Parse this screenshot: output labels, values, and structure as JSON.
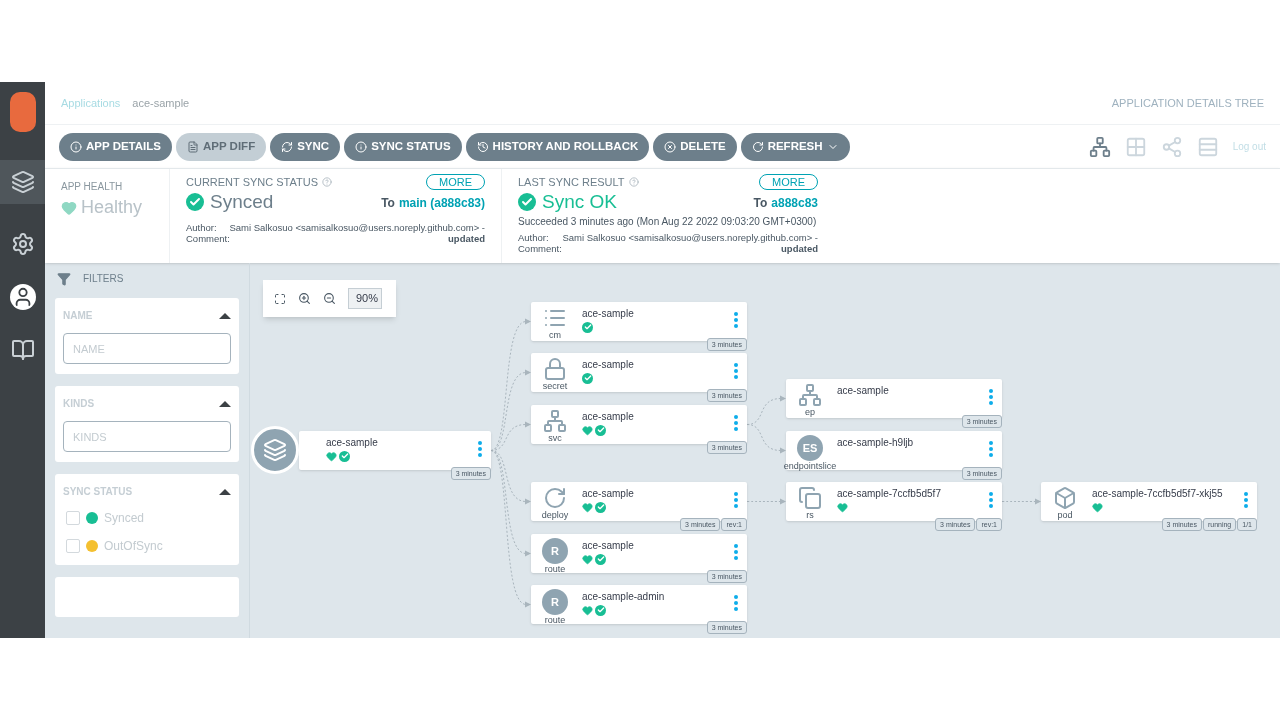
{
  "breadcrumb": [
    {
      "label": "Applications",
      "kind": "link"
    },
    {
      "label": "ace-sample",
      "kind": "current"
    }
  ],
  "page_title": "APPLICATION DETAILS TREE",
  "toolbar": [
    {
      "label": "APP DETAILS",
      "kind": "details",
      "disabled": false
    },
    {
      "label": "APP DIFF",
      "kind": "diff",
      "disabled": true
    },
    {
      "label": "SYNC",
      "kind": "sync",
      "disabled": false
    },
    {
      "label": "SYNC STATUS",
      "kind": "status",
      "disabled": false
    },
    {
      "label": "HISTORY AND ROLLBACK",
      "kind": "history",
      "disabled": false
    },
    {
      "label": "DELETE",
      "kind": "delete",
      "disabled": false
    },
    {
      "label": "REFRESH",
      "kind": "refresh",
      "disabled": false,
      "dropdown": true
    }
  ],
  "views": [
    {
      "kind": "tree",
      "selected": true
    },
    {
      "kind": "pods",
      "selected": false
    },
    {
      "kind": "network",
      "selected": false
    },
    {
      "kind": "list",
      "selected": false
    }
  ],
  "logout": "Log out",
  "app_health": {
    "title": "APP HEALTH",
    "value": "Healthy"
  },
  "current_sync": {
    "title": "CURRENT SYNC STATUS",
    "more": "MORE",
    "value": "Synced",
    "to_label": "To",
    "revision": "main (a888c83)",
    "author_label": "Author:",
    "author": "Sami Salkosuo <samisalkosuo@users.noreply.github.com> -",
    "comment_label": "Comment:",
    "comment": "updated"
  },
  "last_sync": {
    "title": "LAST SYNC RESULT",
    "more": "MORE",
    "value": "Sync OK",
    "to_label": "To",
    "revision": "a888c83",
    "detail": "Succeeded 3 minutes ago (Mon Aug 22 2022 09:03:20 GMT+0300)",
    "author_label": "Author:",
    "author": "Sami Salkosuo <samisalkosuo@users.noreply.github.com> -",
    "comment_label": "Comment:",
    "comment": "updated"
  },
  "filters": {
    "title": "FILTERS",
    "sections": [
      {
        "title": "NAME",
        "kind": "input",
        "placeholder": "NAME",
        "expanded": true
      },
      {
        "title": "KINDS",
        "kind": "input",
        "placeholder": "KINDS",
        "expanded": true
      },
      {
        "title": "SYNC STATUS",
        "kind": "checklist",
        "expanded": true,
        "options": [
          {
            "label": "Synced",
            "checked": false,
            "color": "#18be94"
          },
          {
            "label": "OutOfSync",
            "checked": false,
            "color": "#f4c030"
          }
        ]
      }
    ]
  },
  "graph": {
    "zoom": "90%",
    "root": {
      "kind": "app",
      "name": "ace-sample",
      "health": true,
      "synced": true,
      "badges": [
        "3 minutes"
      ],
      "children": [
        {
          "kind": "cm",
          "name": "ace-sample",
          "health": false,
          "synced": true,
          "badges": [
            "3 minutes"
          ]
        },
        {
          "kind": "secret",
          "name": "ace-sample",
          "health": false,
          "synced": true,
          "badges": [
            "3 minutes"
          ]
        },
        {
          "kind": "svc",
          "name": "ace-sample",
          "health": true,
          "synced": true,
          "badges": [
            "3 minutes"
          ],
          "children": [
            {
              "kind": "ep",
              "name": "ace-sample",
              "health": false,
              "synced": false,
              "badges": [
                "3 minutes"
              ]
            },
            {
              "kind": "endpointslice",
              "icon_text": "ES",
              "name": "ace-sample-h9ljb",
              "health": false,
              "synced": false,
              "badges": [
                "3 minutes"
              ]
            }
          ]
        },
        {
          "kind": "deploy",
          "name": "ace-sample",
          "health": true,
          "synced": true,
          "badges": [
            "3 minutes",
            "rev:1"
          ],
          "children": [
            {
              "kind": "rs",
              "name": "ace-sample-7ccfb5d5f7",
              "health": true,
              "synced": false,
              "badges": [
                "3 minutes",
                "rev:1"
              ],
              "children": [
                {
                  "kind": "pod",
                  "name": "ace-sample-7ccfb5d5f7-xkj55",
                  "health": true,
                  "synced": false,
                  "badges": [
                    "3 minutes",
                    "running",
                    "1/1"
                  ]
                }
              ]
            }
          ]
        },
        {
          "kind": "route",
          "icon_text": "R",
          "name": "ace-sample",
          "health": true,
          "synced": true,
          "badges": [
            "3 minutes"
          ]
        },
        {
          "kind": "route",
          "icon_text": "R",
          "name": "ace-sample-admin",
          "health": true,
          "synced": true,
          "badges": [
            "3 minutes"
          ]
        }
      ]
    }
  }
}
